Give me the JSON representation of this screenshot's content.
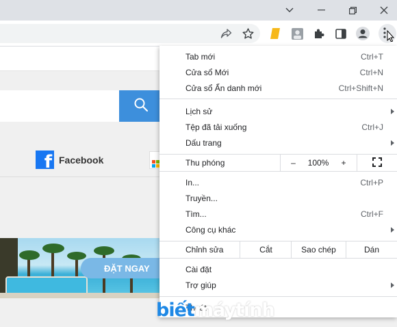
{
  "titlebar": {
    "icons": [
      "chevron-down-icon",
      "minimize-icon",
      "restore-icon",
      "close-icon"
    ]
  },
  "toolbar": {
    "icons": [
      "share-icon",
      "star-icon",
      "extension-yellow-icon",
      "extension-photo-icon",
      "puzzle-icon",
      "side-panel-icon",
      "profile-icon",
      "more-vert-icon"
    ]
  },
  "page": {
    "facebook_label": "Facebook",
    "cta_label": "ĐẶT NGAY"
  },
  "menu": {
    "group1": [
      {
        "label": "Tab mới",
        "shortcut": "Ctrl+T"
      },
      {
        "label": "Cửa sổ Mới",
        "shortcut": "Ctrl+N"
      },
      {
        "label": "Cửa sổ Ẩn danh mới",
        "shortcut": "Ctrl+Shift+N"
      }
    ],
    "group2": [
      {
        "label": "Lịch sử",
        "shortcut": ""
      },
      {
        "label": "Tệp đã tải xuống",
        "shortcut": "Ctrl+J"
      },
      {
        "label": "Dấu trang",
        "shortcut": ""
      }
    ],
    "zoom": {
      "label": "Thu phóng",
      "minus": "–",
      "value": "100%",
      "plus": "+"
    },
    "group3": [
      {
        "label": "In...",
        "shortcut": "Ctrl+P"
      },
      {
        "label": "Truyền...",
        "shortcut": ""
      },
      {
        "label": "Tìm...",
        "shortcut": "Ctrl+F"
      },
      {
        "label": "Công cụ khác",
        "shortcut": ""
      }
    ],
    "edit": {
      "label": "Chỉnh sửa",
      "cut": "Cắt",
      "copy": "Sao chép",
      "paste": "Dán"
    },
    "group4": [
      {
        "label": "Cài đặt",
        "shortcut": ""
      },
      {
        "label": "Trợ giúp",
        "shortcut": ""
      }
    ],
    "exit": {
      "label": "Thoát"
    }
  },
  "watermark": {
    "part1": "biết",
    "part2": "máytính"
  }
}
